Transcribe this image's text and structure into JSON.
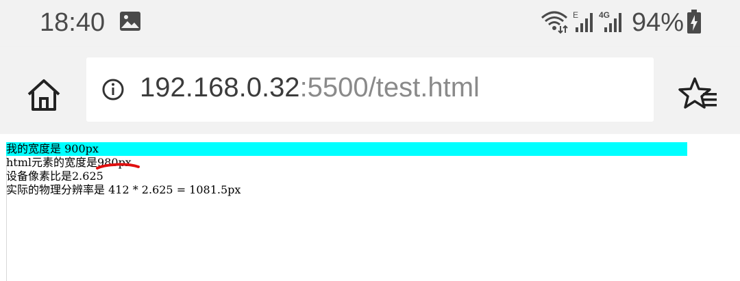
{
  "status_bar": {
    "time": "18:40",
    "battery_percent": "94%",
    "icons": [
      "gallery-icon",
      "wifi-icon",
      "signal-icon",
      "signal-4g-icon",
      "battery-charging-icon"
    ]
  },
  "browser": {
    "url_host": "192.168.0.32",
    "url_path": ":5500/test.html",
    "icons": [
      "home-icon",
      "info-icon",
      "bookmark-star-icon"
    ]
  },
  "page": {
    "banner_text": "我的宽度是 900px",
    "html_width_text": "html元素的宽度是980px",
    "dpr_text": "设备像素比是2.625",
    "physical_text": "实际的物理分辨率是 412 * 2.625 = 1081.5px"
  },
  "colors": {
    "banner": "#00ffff",
    "annotation": "#e01010",
    "chrome_bg": "#f2f2f2"
  }
}
